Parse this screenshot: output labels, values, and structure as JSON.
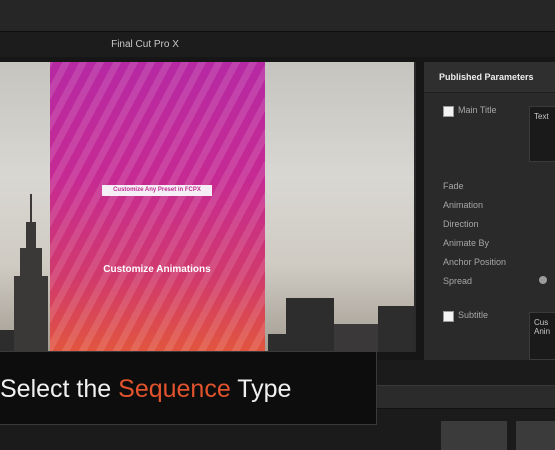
{
  "app": {
    "title": "Final Cut Pro X"
  },
  "viewer": {
    "preset_text": "Customize Any Preset in FCPX",
    "animation_text": "Customize Animations"
  },
  "inspector": {
    "header": "Published Parameters",
    "main_title_label": "Main Title",
    "main_title_value": "Text",
    "params": [
      "Fade",
      "Animation",
      "Direction",
      "Animate By",
      "Anchor Position",
      "Spread"
    ],
    "subtitle_label": "Subtitle",
    "subtitle_value_line1": "Cus",
    "subtitle_value_line2": "Anin"
  },
  "caption": {
    "prefix": "Select the ",
    "highlight": "Sequence",
    "suffix": " Type",
    "highlight_color": "#e1532c"
  }
}
